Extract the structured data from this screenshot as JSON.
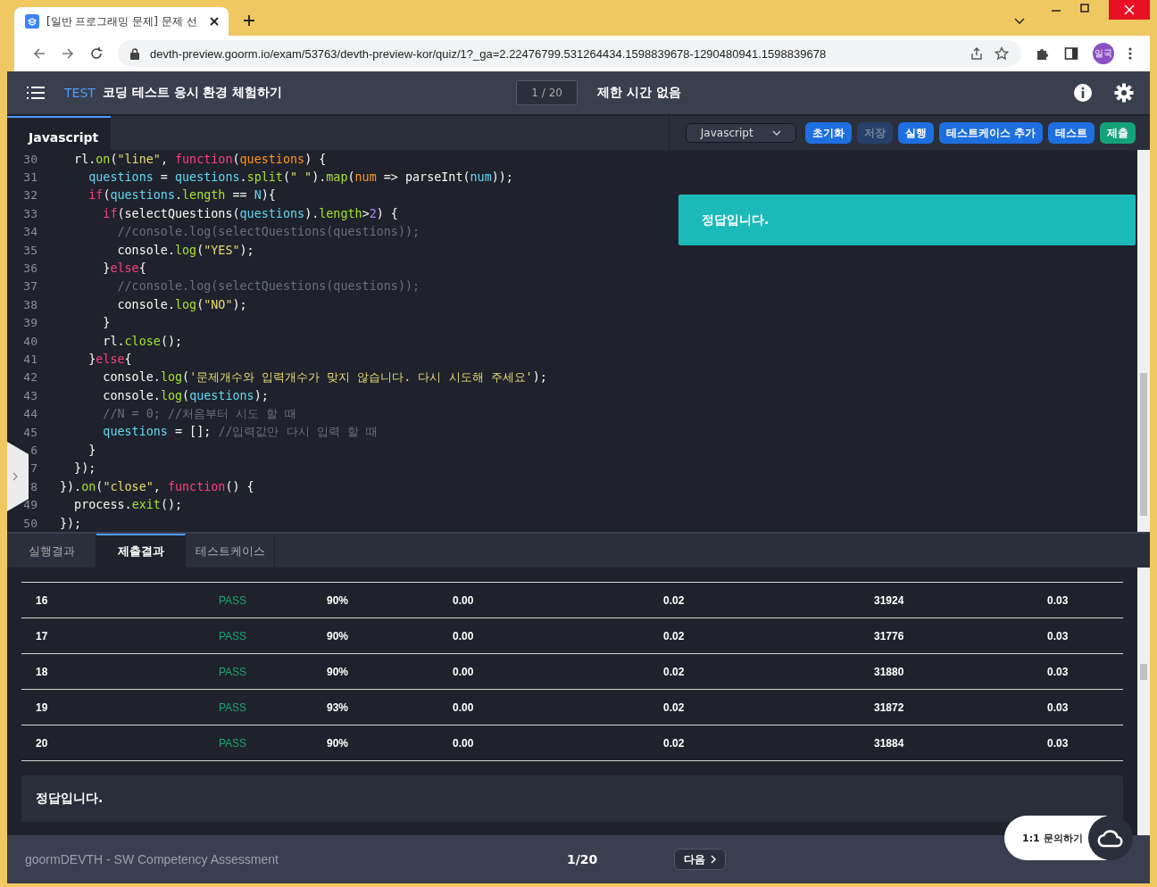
{
  "browser": {
    "tab_title": "[일반 프로그래밍 문제] 문제 선",
    "url": "devth-preview.goorm.io/exam/53763/devth-preview-kor/quiz/1?_ga=2.22476799.531264434.1598839678-1290480941.1598839678",
    "profile": "일국"
  },
  "header": {
    "badge": "TEST",
    "title": "코딩 테스트 응시 환경 체험하기",
    "counter": "1 / 20",
    "time_limit": "제한 시간 없음"
  },
  "editor": {
    "file_tabs": [
      {
        "label": "Javascript",
        "selected": true
      }
    ],
    "language": "Javascript",
    "buttons": [
      {
        "label": "초기화",
        "kind": "primary",
        "disabled": false
      },
      {
        "label": "저장",
        "kind": "primary",
        "disabled": true
      },
      {
        "label": "실행",
        "kind": "primary",
        "disabled": false
      },
      {
        "label": "테스트케이스 추가",
        "kind": "primary",
        "disabled": false
      },
      {
        "label": "테스트",
        "kind": "primary",
        "disabled": false
      },
      {
        "label": "제출",
        "kind": "success",
        "disabled": false
      }
    ],
    "code_lines": [
      {
        "number": "30",
        "tokens": [
          {
            "t": "  rl.",
            "kind": "plain"
          },
          {
            "t": "on",
            "kind": "method"
          },
          {
            "t": "(",
            "kind": "plain"
          },
          {
            "t": "\"line\"",
            "kind": "string"
          },
          {
            "t": ", ",
            "kind": "plain"
          },
          {
            "t": "function",
            "kind": "keyword"
          },
          {
            "t": "(",
            "kind": "plain"
          },
          {
            "t": "questions",
            "kind": "param"
          },
          {
            "t": ") {",
            "kind": "plain"
          }
        ]
      },
      {
        "number": "31",
        "tokens": [
          {
            "t": "    questions",
            "kind": "var"
          },
          {
            "t": " = ",
            "kind": "plain"
          },
          {
            "t": "questions",
            "kind": "var"
          },
          {
            "t": ".",
            "kind": "plain"
          },
          {
            "t": "split",
            "kind": "method"
          },
          {
            "t": "(",
            "kind": "plain"
          },
          {
            "t": "\" \"",
            "kind": "string"
          },
          {
            "t": ").",
            "kind": "plain"
          },
          {
            "t": "map",
            "kind": "method"
          },
          {
            "t": "(",
            "kind": "plain"
          },
          {
            "t": "num",
            "kind": "param"
          },
          {
            "t": " => parseInt(",
            "kind": "plain"
          },
          {
            "t": "num",
            "kind": "var"
          },
          {
            "t": "));",
            "kind": "plain"
          }
        ]
      },
      {
        "number": "32",
        "tokens": [
          {
            "t": "    if",
            "kind": "keyword"
          },
          {
            "t": "(",
            "kind": "plain"
          },
          {
            "t": "questions",
            "kind": "var"
          },
          {
            "t": ".",
            "kind": "plain"
          },
          {
            "t": "length",
            "kind": "method"
          },
          {
            "t": " == ",
            "kind": "plain"
          },
          {
            "t": "N",
            "kind": "var"
          },
          {
            "t": "){",
            "kind": "plain"
          }
        ]
      },
      {
        "number": "33",
        "tokens": [
          {
            "t": "      if",
            "kind": "keyword"
          },
          {
            "t": "(selectQuestions(",
            "kind": "plain"
          },
          {
            "t": "questions",
            "kind": "var"
          },
          {
            "t": ").",
            "kind": "plain"
          },
          {
            "t": "length",
            "kind": "method"
          },
          {
            "t": ">",
            "kind": "plain"
          },
          {
            "t": "2",
            "kind": "number"
          },
          {
            "t": ") {",
            "kind": "plain"
          }
        ]
      },
      {
        "number": "34",
        "tokens": [
          {
            "t": "        //console.log(selectQuestions(questions));",
            "kind": "comment"
          }
        ]
      },
      {
        "number": "35",
        "tokens": [
          {
            "t": "        console.",
            "kind": "plain"
          },
          {
            "t": "log",
            "kind": "method"
          },
          {
            "t": "(",
            "kind": "plain"
          },
          {
            "t": "\"YES\"",
            "kind": "string"
          },
          {
            "t": ");",
            "kind": "plain"
          }
        ]
      },
      {
        "number": "36",
        "tokens": [
          {
            "t": "      }",
            "kind": "plain"
          },
          {
            "t": "else",
            "kind": "keyword"
          },
          {
            "t": "{",
            "kind": "plain"
          }
        ]
      },
      {
        "number": "37",
        "tokens": [
          {
            "t": "        //console.log(selectQuestions(questions));",
            "kind": "comment"
          }
        ]
      },
      {
        "number": "38",
        "tokens": [
          {
            "t": "        console.",
            "kind": "plain"
          },
          {
            "t": "log",
            "kind": "method"
          },
          {
            "t": "(",
            "kind": "plain"
          },
          {
            "t": "\"NO\"",
            "kind": "string"
          },
          {
            "t": ");",
            "kind": "plain"
          }
        ]
      },
      {
        "number": "39",
        "tokens": [
          {
            "t": "      }",
            "kind": "plain"
          }
        ]
      },
      {
        "number": "40",
        "tokens": [
          {
            "t": "      rl.",
            "kind": "plain"
          },
          {
            "t": "close",
            "kind": "method"
          },
          {
            "t": "();",
            "kind": "plain"
          }
        ]
      },
      {
        "number": "41",
        "tokens": [
          {
            "t": "    }",
            "kind": "plain"
          },
          {
            "t": "else",
            "kind": "keyword"
          },
          {
            "t": "{",
            "kind": "plain"
          }
        ]
      },
      {
        "number": "42",
        "tokens": [
          {
            "t": "      console.",
            "kind": "plain"
          },
          {
            "t": "log",
            "kind": "method"
          },
          {
            "t": "(",
            "kind": "plain"
          },
          {
            "t": "'문제개수와 입력개수가 맞지 않습니다. 다시 시도해 주세요'",
            "kind": "string"
          },
          {
            "t": ");",
            "kind": "plain"
          }
        ]
      },
      {
        "number": "43",
        "tokens": [
          {
            "t": "      console.",
            "kind": "plain"
          },
          {
            "t": "log",
            "kind": "method"
          },
          {
            "t": "(",
            "kind": "plain"
          },
          {
            "t": "questions",
            "kind": "var"
          },
          {
            "t": ");",
            "kind": "plain"
          }
        ]
      },
      {
        "number": "44",
        "tokens": [
          {
            "t": "      //N = 0; //처음부터 시도 할 때",
            "kind": "comment"
          }
        ]
      },
      {
        "number": "45",
        "tokens": [
          {
            "t": "      questions",
            "kind": "var"
          },
          {
            "t": " = []; ",
            "kind": "plain"
          },
          {
            "t": "//입력값만 다시 입력 할 때",
            "kind": "comment"
          }
        ]
      },
      {
        "number": "6",
        "tokens": [
          {
            "t": "    }",
            "kind": "plain"
          }
        ]
      },
      {
        "number": "7",
        "tokens": [
          {
            "t": "  });",
            "kind": "plain"
          }
        ]
      },
      {
        "number": "8",
        "tokens": [
          {
            "t": "}).",
            "kind": "plain"
          },
          {
            "t": "on",
            "kind": "method"
          },
          {
            "t": "(",
            "kind": "plain"
          },
          {
            "t": "\"close\"",
            "kind": "string"
          },
          {
            "t": ", ",
            "kind": "plain"
          },
          {
            "t": "function",
            "kind": "keyword"
          },
          {
            "t": "() {",
            "kind": "plain"
          }
        ]
      },
      {
        "number": "49",
        "tokens": [
          {
            "t": "  process.",
            "kind": "plain"
          },
          {
            "t": "exit",
            "kind": "method"
          },
          {
            "t": "();",
            "kind": "plain"
          }
        ]
      },
      {
        "number": "50",
        "tokens": [
          {
            "t": "});",
            "kind": "plain"
          }
        ]
      }
    ],
    "toast": "정답입니다."
  },
  "results": {
    "tabs": [
      {
        "label": "실행결과",
        "selected": false
      },
      {
        "label": "제출결과",
        "selected": true
      },
      {
        "label": "테스트케이스",
        "selected": false
      }
    ],
    "rows": [
      {
        "case": "16",
        "status": "PASS",
        "score": "90%",
        "column_4": "0.00",
        "column_5": "0.02",
        "column_6": "31924",
        "column_7": "0.03"
      },
      {
        "case": "17",
        "status": "PASS",
        "score": "90%",
        "column_4": "0.00",
        "column_5": "0.02",
        "column_6": "31776",
        "column_7": "0.03"
      },
      {
        "case": "18",
        "status": "PASS",
        "score": "90%",
        "column_4": "0.00",
        "column_5": "0.02",
        "column_6": "31880",
        "column_7": "0.03"
      },
      {
        "case": "19",
        "status": "PASS",
        "score": "93%",
        "column_4": "0.00",
        "column_5": "0.02",
        "column_6": "31872",
        "column_7": "0.03"
      },
      {
        "case": "20",
        "status": "PASS",
        "score": "90%",
        "column_4": "0.00",
        "column_5": "0.02",
        "column_6": "31884",
        "column_7": "0.03"
      }
    ],
    "message": "정답입니다."
  },
  "footer": {
    "brand": "goormDEVTH - SW Competency Assessment",
    "page": "1/20",
    "next": "다음",
    "chat": "1:1 문의하기"
  }
}
